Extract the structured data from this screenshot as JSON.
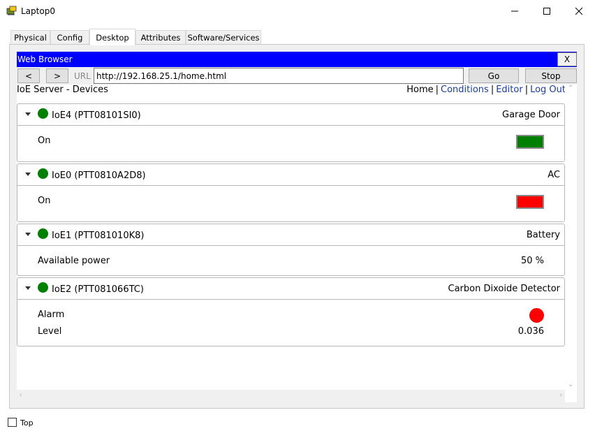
{
  "window": {
    "title": "Laptop0",
    "icon": "laptop-icon",
    "controls": [
      "minimize-icon",
      "maximize-icon",
      "close-icon"
    ]
  },
  "tabs": [
    {
      "label": "Physical",
      "active": false
    },
    {
      "label": "Config",
      "active": false
    },
    {
      "label": "Desktop",
      "active": true
    },
    {
      "label": "Attributes",
      "active": false
    },
    {
      "label": "Software/Services",
      "active": false
    }
  ],
  "browser": {
    "title": "Web Browser",
    "close_label": "X",
    "back_label": "<",
    "forward_label": ">",
    "url_label": "URL",
    "url_value": "http://192.168.25.1/home.html",
    "go_label": "Go",
    "stop_label": "Stop",
    "title_bar_color": "#0000ff"
  },
  "page": {
    "heading": "IoE Server - Devices",
    "nav": {
      "home": "Home",
      "conditions": "Conditions",
      "editor": "Editor",
      "logout": "Log Out",
      "separator": "|"
    },
    "devices": [
      {
        "name": "IoE4 (PTT08101SI0)",
        "type": "Garage Door",
        "status_color": "#008000",
        "property_label": "On",
        "indicator_color": "#008000"
      },
      {
        "name": "IoE0 (PTT0810A2D8)",
        "type": "AC",
        "status_color": "#008000",
        "property_label": "On",
        "indicator_color": "#ff0000"
      },
      {
        "name": "IoE1 (PTT081010K8)",
        "type": "Battery",
        "status_color": "#008000",
        "property_label": "Available power",
        "property_value": "50 %"
      },
      {
        "name": "IoE2 (PTT081066TC)",
        "type": "Carbon Dixoide Detector",
        "status_color": "#008000",
        "alarm_label": "Alarm",
        "alarm_color": "#ff0000",
        "level_label": "Level",
        "level_value": "0.036"
      }
    ]
  },
  "footer": {
    "top_label": "Top",
    "top_checked": false
  }
}
